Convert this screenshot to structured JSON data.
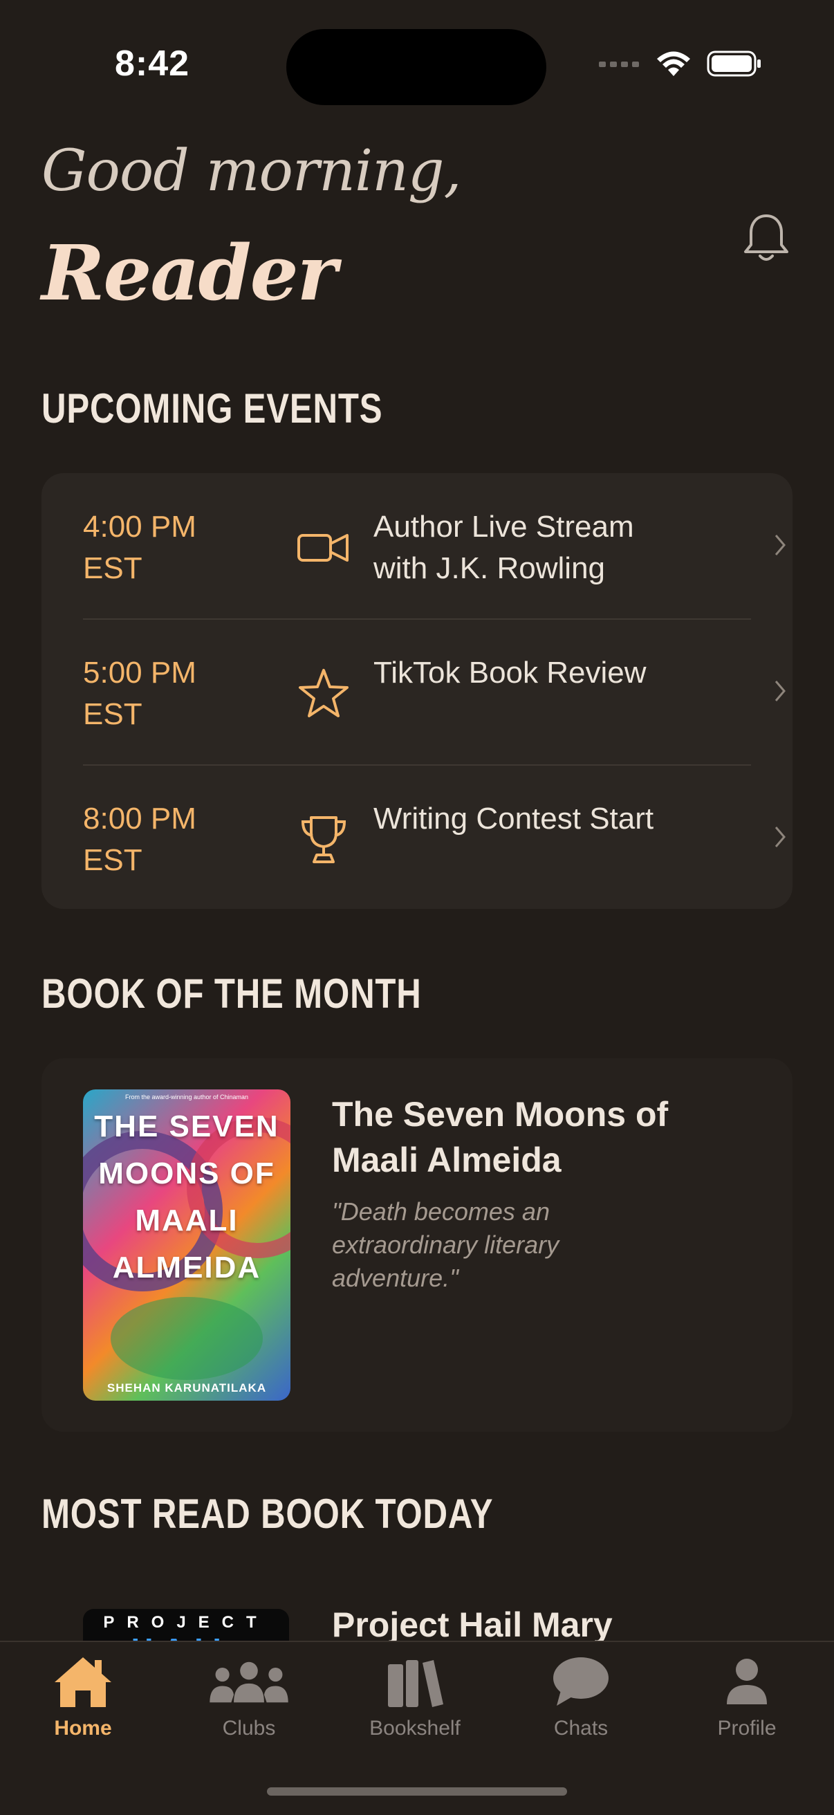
{
  "status_bar": {
    "time": "8:42"
  },
  "header": {
    "greeting": "Good morning,",
    "user_name": "Reader"
  },
  "sections": {
    "upcoming": "UPCOMING EVENTS",
    "book_of_month": "BOOK OF THE MONTH",
    "most_read": "MOST READ BOOK TODAY"
  },
  "events": [
    {
      "time": "4:00 PM EST",
      "icon": "video-camera-icon",
      "title": "Author Live Stream with J.K. Rowling"
    },
    {
      "time": "5:00 PM EST",
      "icon": "star-icon",
      "title": "TikTok Book Review"
    },
    {
      "time": "8:00 PM EST",
      "icon": "trophy-icon",
      "title": "Writing Contest Start"
    }
  ],
  "book_of_month": {
    "title": "The Seven Moons of Maali Almeida",
    "quote": "\"Death becomes an extraordinary literary adventure.\"",
    "cover": {
      "top_line": "From the award-winning author of Chinaman",
      "title": "THE SEVEN MOONS OF MAALI ALMEIDA",
      "author": "SHEHAN KARUNATILAKA"
    }
  },
  "most_read": {
    "title": "Project Hail Mary",
    "cover": {
      "line1": "PROJECT",
      "line2": "HAIL"
    }
  },
  "tabs": [
    {
      "label": "Home",
      "icon": "home-icon",
      "active": true
    },
    {
      "label": "Clubs",
      "icon": "people-icon",
      "active": false
    },
    {
      "label": "Bookshelf",
      "icon": "books-icon",
      "active": false
    },
    {
      "label": "Chats",
      "icon": "chat-bubble-icon",
      "active": false
    },
    {
      "label": "Profile",
      "icon": "person-icon",
      "active": false
    }
  ],
  "colors": {
    "accent": "#f4b56a",
    "background": "#221d19",
    "card": "#2b2622"
  }
}
